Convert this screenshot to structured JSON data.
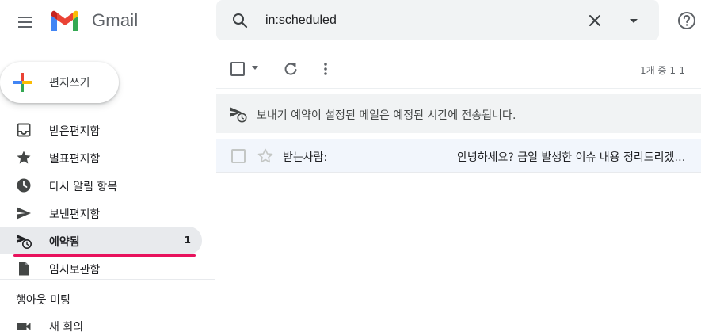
{
  "app": {
    "name": "Gmail",
    "brand_colors": {
      "red": "#ea4335",
      "blue": "#4285f4",
      "green": "#34a853",
      "yellow": "#fbbc04",
      "darkred": "#c5221f"
    }
  },
  "header": {
    "menu_icon": "hamburger-menu-icon",
    "search": {
      "value": "in:scheduled",
      "icon": "search-icon",
      "clear_icon": "close-icon",
      "options_icon": "dropdown-arrow-icon"
    },
    "help_icon": "help-icon"
  },
  "sidebar": {
    "compose_label": "편지쓰기",
    "items": [
      {
        "label": "받은편지함",
        "icon": "inbox-icon",
        "count": ""
      },
      {
        "label": "별표편지함",
        "icon": "star-icon",
        "count": ""
      },
      {
        "label": "다시 알림 항목",
        "icon": "snooze-clock-icon",
        "count": ""
      },
      {
        "label": "보낸편지함",
        "icon": "send-icon",
        "count": ""
      },
      {
        "label": "예약됨",
        "icon": "scheduled-send-icon",
        "count": "1",
        "active": true
      },
      {
        "label": "임시보관함",
        "icon": "draft-icon",
        "count": ""
      }
    ],
    "active_accent": "#e8125c",
    "meet": {
      "title": "행아웃 미팅",
      "new_meeting_label": "새 회의",
      "new_meeting_icon": "video-camera-icon"
    }
  },
  "main": {
    "toolbar": {
      "select_icon": "checkbox-icon",
      "refresh_icon": "refresh-icon",
      "more_icon": "more-vert-icon",
      "pagination": "1개 중 1-1"
    },
    "banner": {
      "icon": "scheduled-send-icon",
      "text": "보내기 예약이 설정된 메일은 예정된 시간에 전송됩니다."
    },
    "emails": [
      {
        "to": "받는사람:",
        "subject": "안녕하세요? 금일 발생한 이슈 내용 정리드리겠습니다."
      }
    ]
  }
}
